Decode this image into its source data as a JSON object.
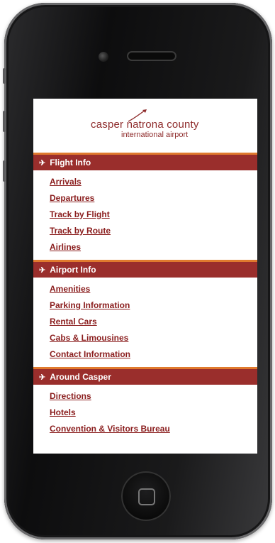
{
  "header": {
    "logo_line1": "casper natrona county",
    "logo_line2": "international airport"
  },
  "sections": [
    {
      "title": "Flight Info",
      "links": [
        "Arrivals",
        "Departures",
        "Track by Flight",
        "Track by Route",
        "Airlines"
      ]
    },
    {
      "title": "Airport Info",
      "links": [
        "Amenities",
        "Parking Information",
        "Rental Cars",
        "Cabs & Limousines",
        "Contact Information"
      ]
    },
    {
      "title": "Around Casper",
      "links": [
        "Directions",
        "Hotels",
        "Convention & Visitors Bureau"
      ]
    }
  ],
  "icons": {
    "section_icon": "airplane-icon",
    "home_button": "home-square-icon"
  },
  "colors": {
    "brand": "#9a2e2c",
    "accent": "#e07a2e",
    "link": "#8a1d1d"
  }
}
